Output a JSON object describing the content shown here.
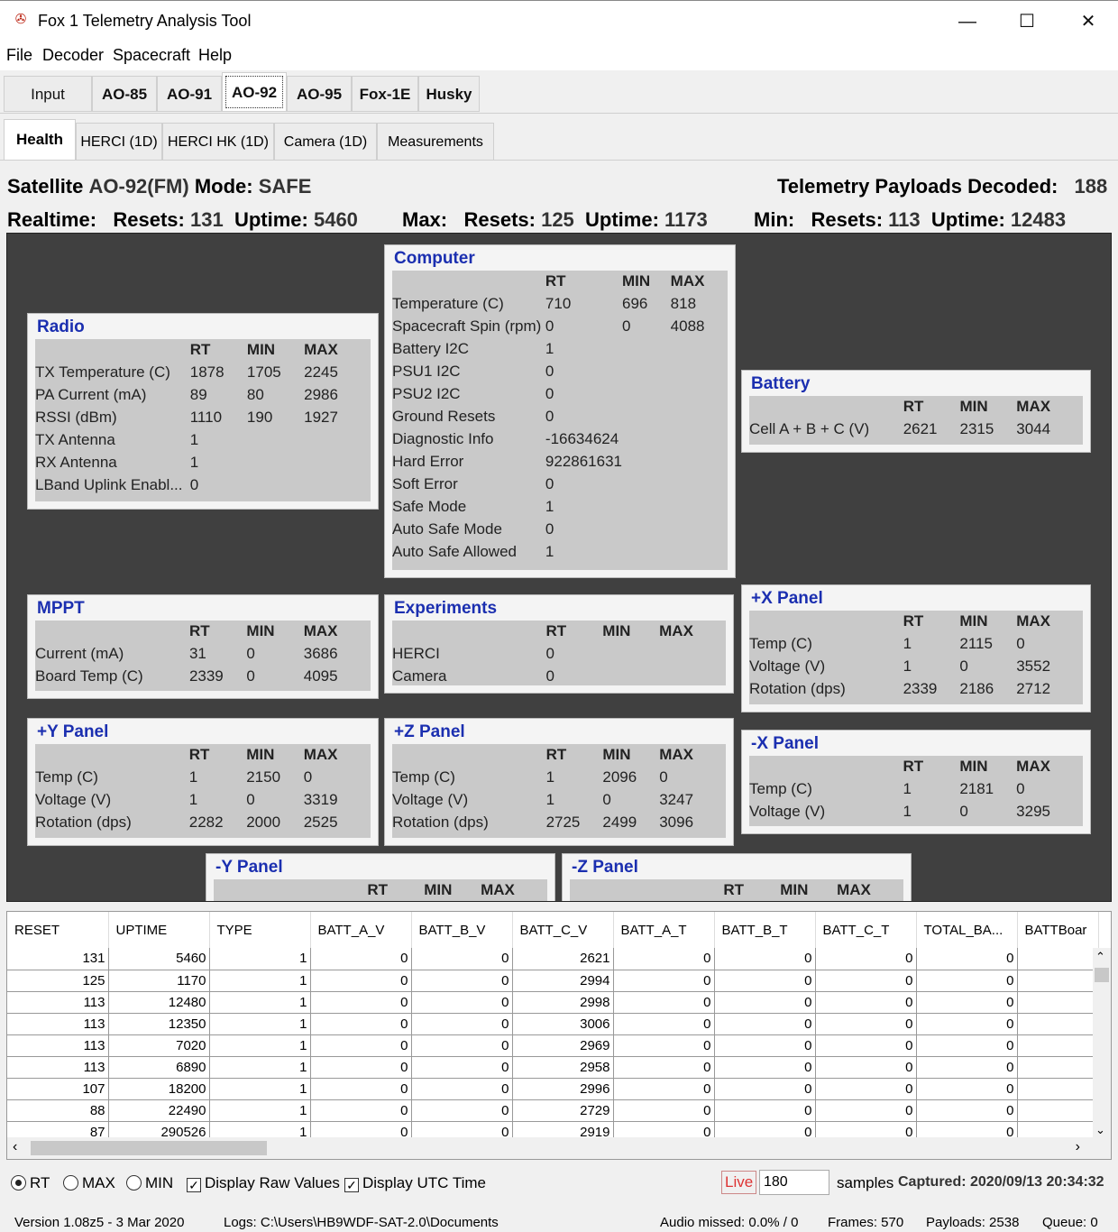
{
  "app": {
    "title": "Fox 1 Telemetry Analysis Tool"
  },
  "menu": [
    "File",
    "Decoder",
    "Spacecraft",
    "Help"
  ],
  "sat_tabs": [
    "Input",
    "AO-85",
    "AO-91",
    "AO-92",
    "AO-95",
    "Fox-1E",
    "Husky"
  ],
  "sub_tabs": [
    "Health",
    "HERCI (1D)",
    "HERCI HK (1D)",
    "Camera (1D)",
    "Measurements"
  ],
  "header": {
    "sat_label": "Satellite",
    "sat_value": "AO-92(FM)",
    "mode_label": "Mode:",
    "mode_value": "SAFE",
    "payloads_label": "Telemetry Payloads Decoded:",
    "payloads_value": "188",
    "realtime_label": "Realtime:",
    "max_label": "Max:",
    "min_label": "Min:",
    "resets_label": "Resets:",
    "uptime_label": "Uptime:",
    "rt_resets": "131",
    "rt_uptime": "5460",
    "max_resets": "125",
    "max_uptime": "1173",
    "min_resets": "113",
    "min_uptime": "12483"
  },
  "cols": {
    "rt": "RT",
    "min": "MIN",
    "max": "MAX"
  },
  "modules": {
    "computer": {
      "title": "Computer",
      "rows": [
        [
          "Temperature (C)",
          "710",
          "696",
          "818"
        ],
        [
          "Spacecraft Spin (rpm)",
          "0",
          "0",
          "4088"
        ],
        [
          "Battery I2C",
          "1",
          "",
          ""
        ],
        [
          "PSU1 I2C",
          "0",
          "",
          ""
        ],
        [
          "PSU2 I2C",
          "0",
          "",
          ""
        ],
        [
          "Ground Resets",
          "0",
          "",
          ""
        ],
        [
          "Diagnostic Info",
          "-16634624",
          "",
          ""
        ],
        [
          "Hard Error",
          "922861631",
          "",
          ""
        ],
        [
          "Soft Error",
          "0",
          "",
          ""
        ],
        [
          "Safe Mode",
          "1",
          "",
          ""
        ],
        [
          "Auto Safe Mode",
          "0",
          "",
          ""
        ],
        [
          "Auto Safe Allowed",
          "1",
          "",
          ""
        ]
      ]
    },
    "radio": {
      "title": "Radio",
      "rows": [
        [
          "TX Temperature (C)",
          "1878",
          "1705",
          "2245"
        ],
        [
          "PA Current (mA)",
          "89",
          "80",
          "2986"
        ],
        [
          "RSSI (dBm)",
          "1110",
          "190",
          "1927"
        ],
        [
          "TX Antenna",
          "1",
          "",
          ""
        ],
        [
          "RX Antenna",
          "1",
          "",
          ""
        ],
        [
          "LBand Uplink Enabl...",
          "0",
          "",
          ""
        ]
      ]
    },
    "battery": {
      "title": "Battery",
      "rows": [
        [
          "Cell A + B + C (V)",
          "2621",
          "2315",
          "3044"
        ]
      ]
    },
    "mppt": {
      "title": "MPPT",
      "rows": [
        [
          "Current (mA)",
          "31",
          "0",
          "3686"
        ],
        [
          "Board Temp (C)",
          "2339",
          "0",
          "4095"
        ]
      ]
    },
    "experiments": {
      "title": "Experiments",
      "rows": [
        [
          "HERCI",
          "0",
          "",
          ""
        ],
        [
          "Camera",
          "0",
          "",
          ""
        ]
      ]
    },
    "xplus": {
      "title": "+X Panel",
      "rows": [
        [
          "Temp (C)",
          "1",
          "2115",
          "0"
        ],
        [
          "Voltage (V)",
          "1",
          "0",
          "3552"
        ],
        [
          "Rotation (dps)",
          "2339",
          "2186",
          "2712"
        ]
      ]
    },
    "yplus": {
      "title": "+Y Panel",
      "rows": [
        [
          "Temp (C)",
          "1",
          "2150",
          "0"
        ],
        [
          "Voltage (V)",
          "1",
          "0",
          "3319"
        ],
        [
          "Rotation (dps)",
          "2282",
          "2000",
          "2525"
        ]
      ]
    },
    "zplus": {
      "title": "+Z Panel",
      "rows": [
        [
          "Temp (C)",
          "1",
          "2096",
          "0"
        ],
        [
          "Voltage (V)",
          "1",
          "0",
          "3247"
        ],
        [
          "Rotation (dps)",
          "2725",
          "2499",
          "3096"
        ]
      ]
    },
    "xminus": {
      "title": "-X Panel",
      "rows": [
        [
          "Temp (C)",
          "1",
          "2181",
          "0"
        ],
        [
          "Voltage (V)",
          "1",
          "0",
          "3295"
        ]
      ]
    },
    "yminus": {
      "title": "-Y Panel",
      "rows": []
    },
    "zminus": {
      "title": "-Z Panel",
      "rows": []
    }
  },
  "grid": {
    "headers": [
      "RESET",
      "UPTIME",
      "TYPE",
      "BATT_A_V",
      "BATT_B_V",
      "BATT_C_V",
      "BATT_A_T",
      "BATT_B_T",
      "BATT_C_T",
      "TOTAL_BA...",
      "BATTBoar"
    ],
    "rows": [
      [
        "131",
        "5460",
        "1",
        "0",
        "0",
        "2621",
        "0",
        "0",
        "0",
        "0",
        ""
      ],
      [
        "125",
        "1170",
        "1",
        "0",
        "0",
        "2994",
        "0",
        "0",
        "0",
        "0",
        ""
      ],
      [
        "113",
        "12480",
        "1",
        "0",
        "0",
        "2998",
        "0",
        "0",
        "0",
        "0",
        ""
      ],
      [
        "113",
        "12350",
        "1",
        "0",
        "0",
        "3006",
        "0",
        "0",
        "0",
        "0",
        ""
      ],
      [
        "113",
        "7020",
        "1",
        "0",
        "0",
        "2969",
        "0",
        "0",
        "0",
        "0",
        ""
      ],
      [
        "113",
        "6890",
        "1",
        "0",
        "0",
        "2958",
        "0",
        "0",
        "0",
        "0",
        ""
      ],
      [
        "107",
        "18200",
        "1",
        "0",
        "0",
        "2996",
        "0",
        "0",
        "0",
        "0",
        ""
      ],
      [
        "88",
        "22490",
        "1",
        "0",
        "0",
        "2729",
        "0",
        "0",
        "0",
        "0",
        ""
      ],
      [
        "87",
        "290526",
        "1",
        "0",
        "0",
        "2919",
        "0",
        "0",
        "0",
        "0",
        ""
      ]
    ]
  },
  "controls": {
    "rt": "RT",
    "max": "MAX",
    "min": "MIN",
    "raw": "Display Raw Values",
    "utc": "Display UTC Time",
    "live": "Live",
    "samples_value": "180",
    "samples_label": "samples",
    "captured": "Captured: 2020/09/13 20:34:32"
  },
  "status": {
    "version": "Version 1.08z5 - 3 Mar 2020",
    "logs": "Logs: C:\\Users\\HB9WDF-SAT-2.0\\Documents",
    "audio": "Audio missed: 0.0% / 0",
    "frames": "Frames: 570",
    "payloads": "Payloads: 2538",
    "queue": "Queue: 0"
  }
}
